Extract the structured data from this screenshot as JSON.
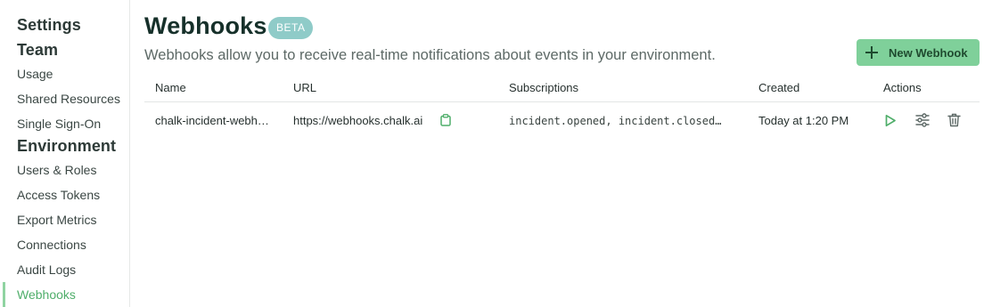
{
  "sidebar": {
    "settings_heading": "Settings",
    "team_heading": "Team",
    "team_items": [
      "Usage",
      "Shared Resources",
      "Single Sign-On"
    ],
    "environment_heading": "Environment",
    "environment_items": [
      "Users & Roles",
      "Access Tokens",
      "Export Metrics",
      "Connections",
      "Audit Logs",
      "Webhooks"
    ],
    "active_item": "Webhooks"
  },
  "header": {
    "title": "Webhooks",
    "badge": "BETA",
    "subtitle": "Webhooks allow you to receive real-time notifications about events in your environment.",
    "new_button_label": "New Webhook"
  },
  "table": {
    "columns": [
      "Name",
      "URL",
      "Subscriptions",
      "Created",
      "Actions"
    ],
    "rows": [
      {
        "name": "chalk-incident-webh…",
        "url": "https://webhooks.chalk.ai",
        "subscriptions": "incident.opened, incident.closed…",
        "created": "Today at 1:20 PM"
      }
    ]
  },
  "colors": {
    "accent": "#4fae6a",
    "button_bg": "#7fd09a",
    "badge_bg": "#8fcbc8"
  },
  "icons": {
    "copy": "clipboard-icon",
    "run": "play-icon",
    "edit": "sliders-icon",
    "delete": "trash-icon"
  }
}
